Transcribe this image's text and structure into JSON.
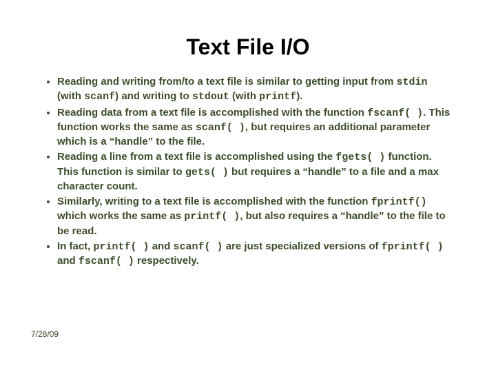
{
  "title": "Text File I/O",
  "bullets": {
    "b1": {
      "t1": "Reading and writing from/to a text file is similar to getting input from ",
      "c1": "stdin",
      "t2": " (with ",
      "c2": "scanf",
      "t3": ") and writing to ",
      "c3": "stdout",
      "t4": " (with ",
      "c4": "printf",
      "t5": ")."
    },
    "b2": {
      "t1": "Reading data from a text file is accomplished with the function ",
      "c1": "fscanf( )",
      "t2": ".  This function works the same as ",
      "c2": "scanf( )",
      "t3": ", but requires an additional parameter which is a “handle” to the file."
    },
    "b3": {
      "t1": "Reading a line from a text file is accomplished using the ",
      "c1": "fgets( )",
      "t2": " function.  This function is similar to ",
      "c2": "gets( )",
      "t3": " but requires a “handle” to a file and a max character count."
    },
    "b4": {
      "t1": "Similarly, writing to a text file is accomplished with the function ",
      "c1": "fprintf()",
      "t2": " which works the same as ",
      "c2": "printf( )",
      "t3": ", but also requires a “handle” to the file to be read."
    },
    "b5": {
      "t1": "In fact, ",
      "c1": "printf( )",
      "t2": " and ",
      "c2": "scanf( )",
      "t3": " are just specialized versions of ",
      "c3": "fprintf( )",
      "t4": " and ",
      "c4": "fscanf( )",
      "t5": " respectively."
    }
  },
  "footer_date": "7/28/09"
}
